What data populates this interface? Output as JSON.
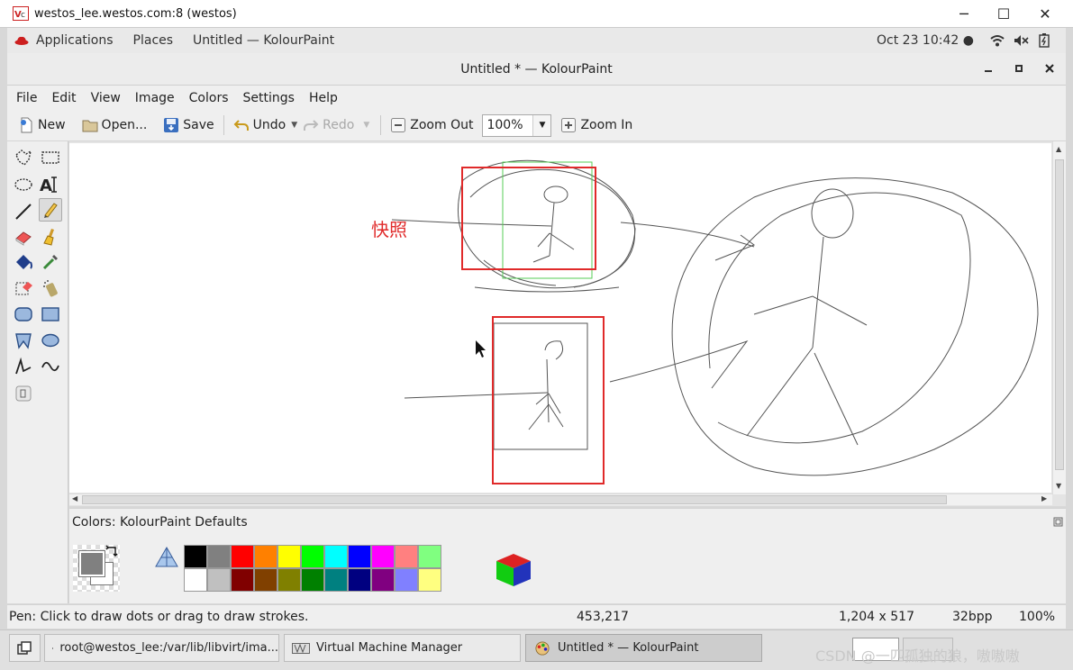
{
  "outer_window": {
    "title": "westos_lee.westos.com:8 (westos)",
    "minimize": "─",
    "maximize": "☐",
    "close": "✕"
  },
  "top_panel": {
    "applications": "Applications",
    "places": "Places",
    "active_app": "Untitled  — KolourPaint",
    "clock": "Oct 23  10:42 ●"
  },
  "window": {
    "title": "Untitled * — KolourPaint"
  },
  "menubar": {
    "items": [
      "File",
      "Edit",
      "View",
      "Image",
      "Colors",
      "Settings",
      "Help"
    ]
  },
  "toolbar": {
    "new": "New",
    "open": "Open...",
    "save": "Save",
    "undo": "Undo",
    "redo": "Redo",
    "zoom_out": "Zoom Out",
    "zoom_level": "100%",
    "zoom_in": "Zoom In"
  },
  "canvas": {
    "annotation_text": "快照",
    "annotation_color": "#e02a2a"
  },
  "colorbox": {
    "label": "Colors: KolourPaint Defaults",
    "foreground": "#808080",
    "background": "#ffffff",
    "row1": [
      "#000000",
      "#808080",
      "#ff0000",
      "#ff8000",
      "#ffff00",
      "#00ff00",
      "#00ffff",
      "#0000ff",
      "#ff00ff",
      "#ff8080",
      "#80ff80"
    ],
    "row2": [
      "#ffffff",
      "#c0c0c0",
      "#800000",
      "#804000",
      "#808000",
      "#008000",
      "#008080",
      "#000080",
      "#800080",
      "#8080ff",
      "#ffff80"
    ]
  },
  "statusbar": {
    "message": "Pen: Click to draw dots or drag to draw strokes.",
    "cursor_pos": "453,217",
    "image_size": "1,204 x 517",
    "depth": "32bpp",
    "zoom": "100%"
  },
  "taskbar": {
    "terminal": "root@westos_lee:/var/lib/libvirt/ima...",
    "virt_manager": "Virtual Machine Manager",
    "kolourpaint": "Untitled * — KolourPaint"
  },
  "watermark": "CSDN @一匹孤独的狼，嗷嗷嗷"
}
